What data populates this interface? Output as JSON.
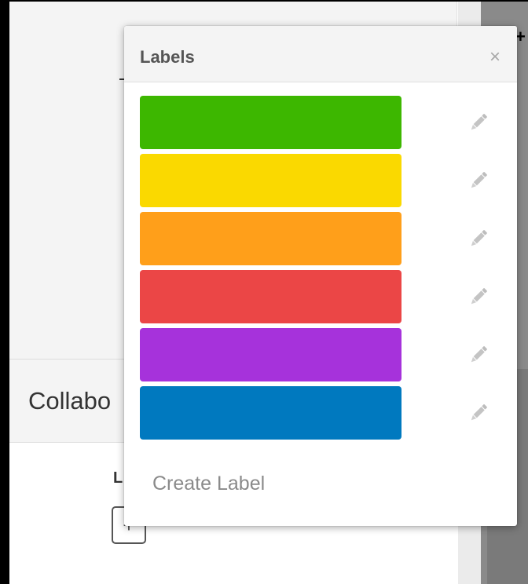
{
  "background": {
    "collaborators_heading": "Collabo",
    "section_letter": "L",
    "add_symbol": "+",
    "corner_symbol": "+"
  },
  "popover": {
    "title": "Labels",
    "close_symbol": "×",
    "close_icon": "close-icon",
    "edit_icon": "pencil-icon",
    "labels": [
      {
        "color": "#3db700"
      },
      {
        "color": "#fad900"
      },
      {
        "color": "#ff9f1a"
      },
      {
        "color": "#eb4646"
      },
      {
        "color": "#a632db"
      },
      {
        "color": "#0079bf"
      }
    ],
    "create_label": "Create Label"
  }
}
